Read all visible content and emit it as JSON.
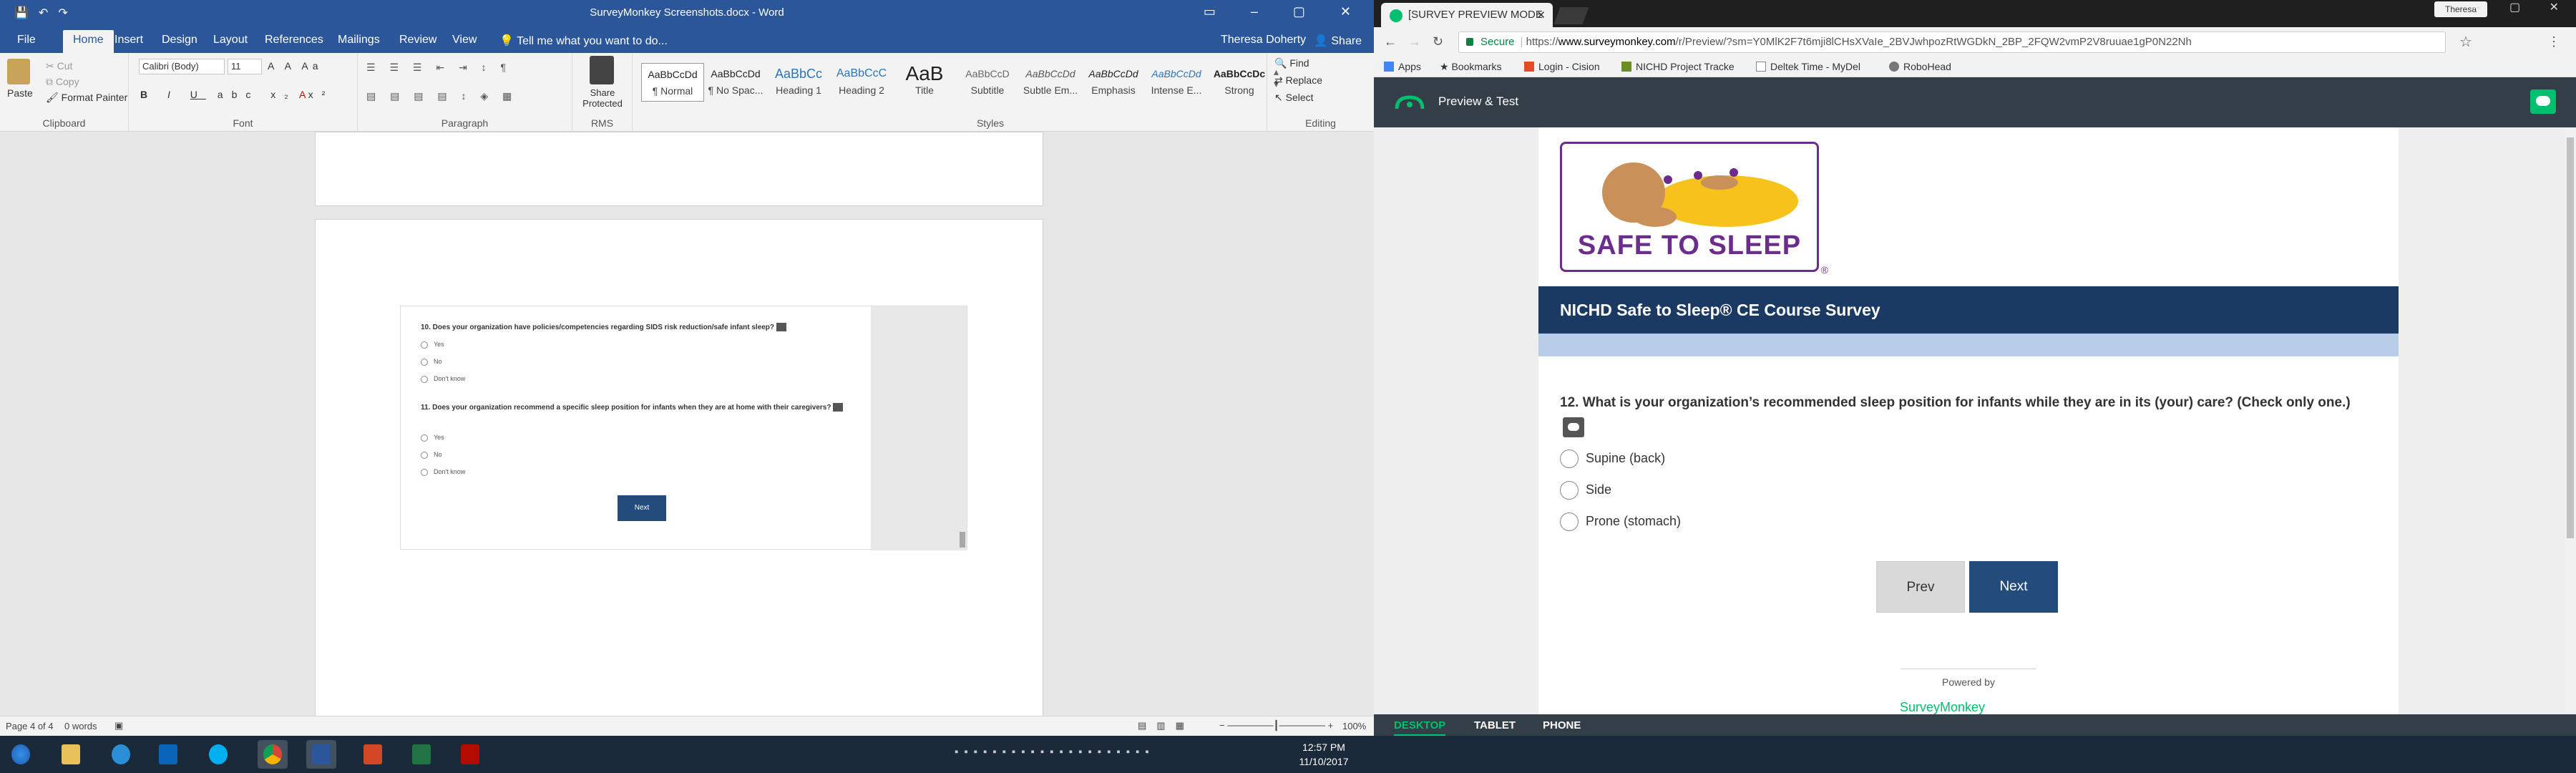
{
  "word": {
    "title": "SurveyMonkey Screenshots.docx - Word",
    "tabs": [
      "File",
      "Home",
      "Insert",
      "Design",
      "Layout",
      "References",
      "Mailings",
      "Review",
      "View"
    ],
    "tell_me": "Tell me what you want to do...",
    "user": "Theresa Doherty",
    "share": "Share",
    "clipboard": {
      "paste": "Paste",
      "cut": "Cut",
      "copy": "Copy",
      "format_painter": "Format Painter",
      "label": "Clipboard"
    },
    "font": {
      "name": "Calibri (Body)",
      "size": "11",
      "label": "Font"
    },
    "paragraph_label": "Paragraph",
    "rms": {
      "button": "Share Protected",
      "label": "RMS"
    },
    "styles": [
      {
        "preview": "AaBbCcDd",
        "name": "¶ Normal"
      },
      {
        "preview": "AaBbCcDd",
        "name": "¶ No Spac..."
      },
      {
        "preview": "AaBbCc",
        "name": "Heading 1"
      },
      {
        "preview": "AaBbCcC",
        "name": "Heading 2"
      },
      {
        "preview": "AaB",
        "name": "Title"
      },
      {
        "preview": "AaBbCcD",
        "name": "Subtitle"
      },
      {
        "preview": "AaBbCcDd",
        "name": "Subtle Em..."
      },
      {
        "preview": "AaBbCcDd",
        "name": "Emphasis"
      },
      {
        "preview": "AaBbCcDd",
        "name": "Intense E..."
      },
      {
        "preview": "AaBbCcDc",
        "name": "Strong"
      }
    ],
    "styles_label": "Styles",
    "editing": {
      "find": "Find",
      "replace": "Replace",
      "select": "Select",
      "label": "Editing"
    },
    "doc": {
      "q10": "10. Does your organization have policies/competencies regarding SIDS risk reduction/safe infant sleep?",
      "q10_options": [
        "Yes",
        "No",
        "Don't know"
      ],
      "q11": "11. Does your organization recommend a specific sleep position for infants when they are at home with their caregivers?",
      "q11_options": [
        "Yes",
        "No",
        "Don't know"
      ],
      "next": "Next"
    },
    "status": {
      "page": "Page 4 of 4",
      "words": "0 words",
      "zoom": "100%"
    }
  },
  "chrome": {
    "tab_title": "[SURVEY PREVIEW MODE",
    "user": "Theresa",
    "address": {
      "secure": "Secure",
      "prefix": "https://",
      "host": "www.surveymonkey.com",
      "path": "/r/Preview/?sm=Y0MlK2F7t6mji8lCHsXVaIe_2BVJwhpozRtWGDkN_2BP_2FQW2vmP2V8ruuae1gP0N22Nh"
    },
    "bookmarks": [
      "Apps",
      "Bookmarks",
      "Login - Cision",
      "NICHD Project Tracke",
      "Deltek Time - MyDel",
      "RoboHead"
    ]
  },
  "survey": {
    "header_title": "Preview & Test",
    "logo_text": "SAFE TO SLEEP",
    "logo_reg": "®",
    "banner": "NICHD Safe to Sleep® CE Course Survey",
    "question": "12. What is your organization’s recommended sleep position for infants while they are in its (your) care? (Check only one.)",
    "options": [
      "Supine (back)",
      "Side",
      "Prone (stomach)"
    ],
    "prev": "Prev",
    "next": "Next",
    "powered_by": "Powered by",
    "brand_partial": "SurveyMonkey",
    "devices": [
      "DESKTOP",
      "TABLET",
      "PHONE"
    ]
  },
  "taskbar": {
    "time": "12:57 PM",
    "date": "11/10/2017"
  },
  "colors": {
    "word_blue": "#2b579a",
    "sm_dark": "#333e48",
    "sm_green": "#00bf6f",
    "banner": "#1b3a63",
    "next_btn": "#234b7c",
    "logo_purple": "#6b2c8d"
  }
}
